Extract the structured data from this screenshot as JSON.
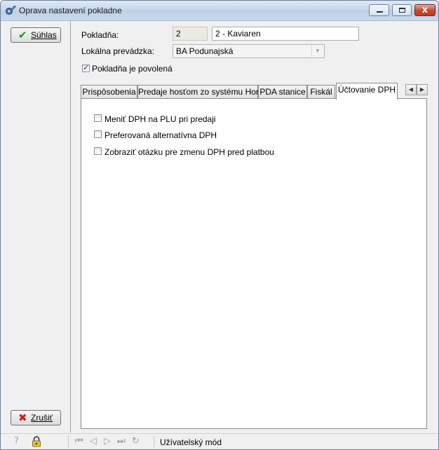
{
  "window": {
    "title": "Oprava nastavení pokladne",
    "close_glyph": "x",
    "app_icon": "gear-wrench-icon"
  },
  "buttons": {
    "accept_label": "Súhlas",
    "cancel_label": "Zrušiť",
    "accept_icon_glyph": "✔",
    "cancel_icon_glyph": "✖",
    "accept_color": "#1a9a1a",
    "cancel_color": "#c8201c"
  },
  "form": {
    "pokladna_label": "Pokladňa:",
    "pokladna_number": "2",
    "pokladna_name": "2 - Kaviaren",
    "prevadzka_label": "Lokálna prevádzka:",
    "prevadzka_value": "BA Podunajská",
    "enabled_label": "Pokladňa je povolená",
    "enabled_checked": true
  },
  "tabs": [
    {
      "label": "Prispôsobenia"
    },
    {
      "label": "Predaje hosťom zo systému Horec"
    },
    {
      "label": "PDA stanice"
    },
    {
      "label": "Fiskál"
    },
    {
      "label": "Účtovanie DPH",
      "active": true
    }
  ],
  "tab_scroll": {
    "left": "◀",
    "right": "▶"
  },
  "vat_options": [
    {
      "label": "Meniť DPH na PLU pri predaji",
      "checked": false
    },
    {
      "label": "Preferovaná alternatívna DPH",
      "checked": false
    },
    {
      "label": "Zobraziť otázku pre zmenu DPH pred platbou",
      "checked": false
    }
  ],
  "statusbar": {
    "mode_text": "Užívatelský mód",
    "icons": [
      "help-icon",
      "lock-icon",
      "first-record-icon",
      "previous-record-icon",
      "next-record-icon",
      "last-record-icon",
      "refresh-icon"
    ]
  }
}
